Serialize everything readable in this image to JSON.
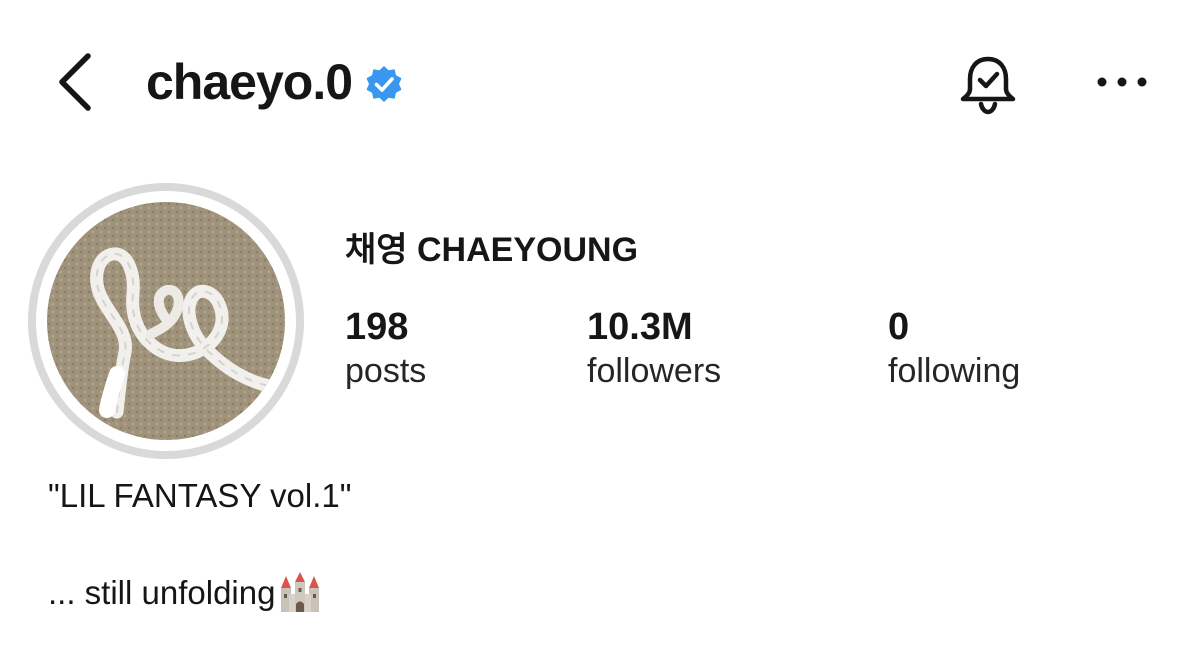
{
  "header": {
    "username": "chaeyo.0",
    "verified_color": "#3897f0",
    "back_icon": "chevron-left-icon",
    "notification_icon": "bell-check-icon",
    "more_icon": "more-horizontal-icon"
  },
  "profile": {
    "full_name": "채영 CHAEYOUNG",
    "stats": {
      "posts": {
        "value": "198",
        "label": "posts"
      },
      "followers": {
        "value": "10.3M",
        "label": "followers"
      },
      "following": {
        "value": "0",
        "label": "following"
      }
    },
    "bio": {
      "line1": "\"LIL FANTASY vol.1\"",
      "line2": "... still unfolding",
      "line2_emoji": "castle-icon"
    }
  }
}
